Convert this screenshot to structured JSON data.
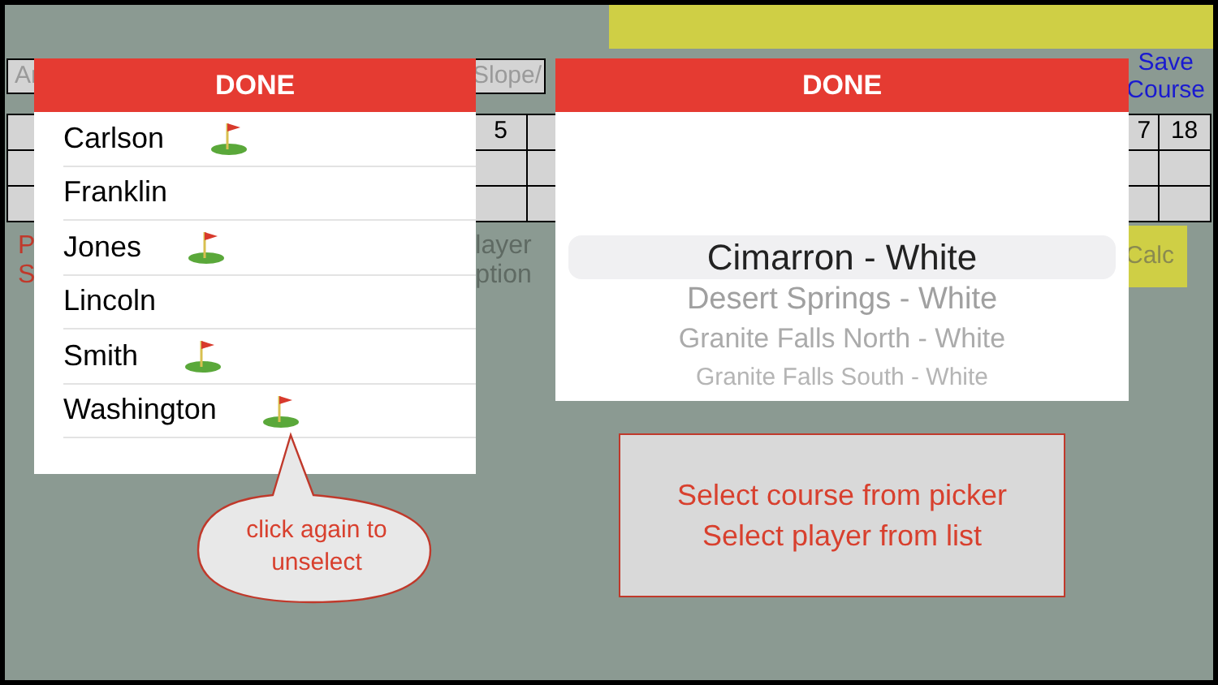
{
  "header": {
    "course_field": {
      "placeholder": "Ar"
    },
    "slope_field": {
      "placeholder": "Slope/"
    },
    "save_link": [
      "Save",
      "Course"
    ]
  },
  "scorecard": {
    "header_cells": [
      "5",
      "7",
      "18"
    ]
  },
  "left_labels": [
    "P",
    "S"
  ],
  "player_labels": [
    "layer",
    "ption"
  ],
  "calc_button": "Calc",
  "player_list": {
    "done": "DONE",
    "items": [
      {
        "name": "Carlson",
        "selected": true
      },
      {
        "name": "Franklin",
        "selected": false
      },
      {
        "name": "Jones",
        "selected": true
      },
      {
        "name": "Lincoln",
        "selected": false
      },
      {
        "name": "Smith",
        "selected": true
      },
      {
        "name": "Washington",
        "selected": true
      }
    ]
  },
  "course_picker": {
    "done": "DONE",
    "options": [
      {
        "label": "Cimarron - White",
        "selected": true
      },
      {
        "label": "Desert Springs - White",
        "selected": false
      },
      {
        "label": "Granite Falls North - White",
        "selected": false
      },
      {
        "label": "Granite Falls South - White",
        "selected": false
      }
    ]
  },
  "callout": "click again to unselect",
  "instructions": [
    "Select course from picker",
    "Select player from list"
  ]
}
